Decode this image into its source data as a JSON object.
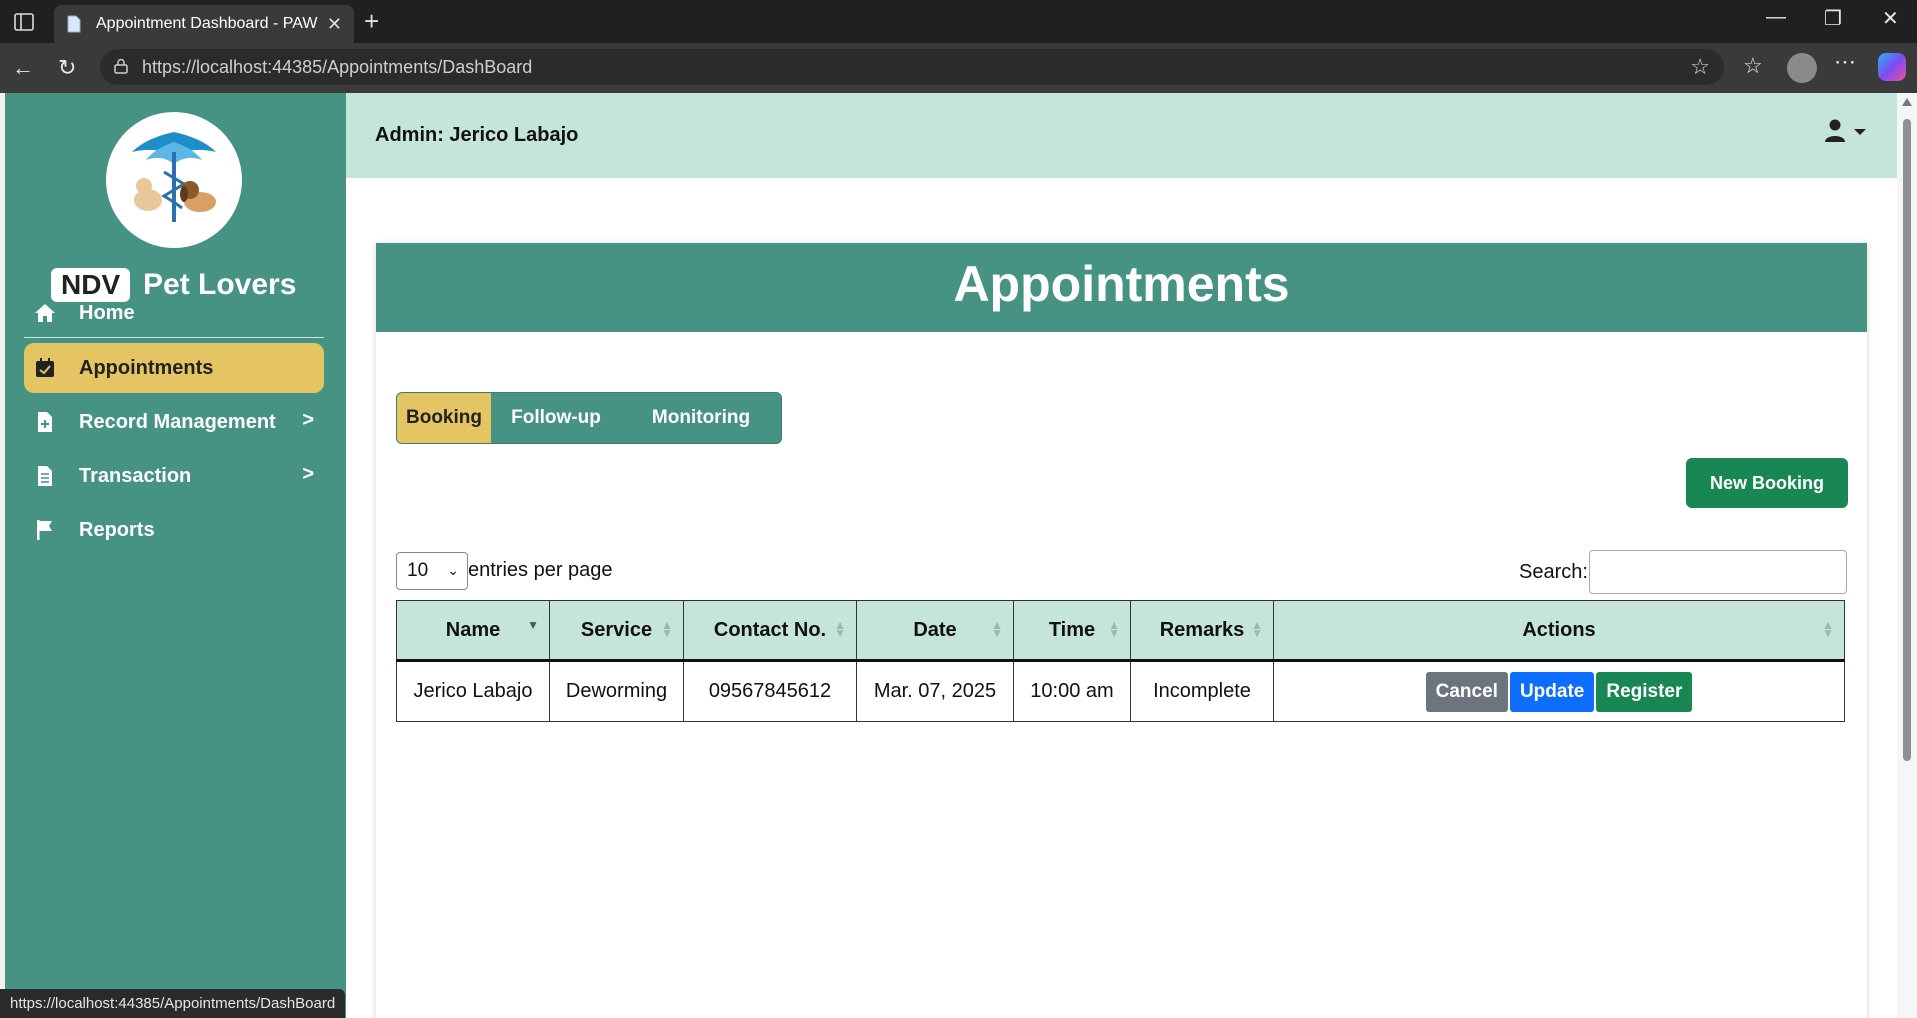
{
  "browser": {
    "tab_title": "Appointment Dashboard - PAWS_",
    "url_host": "https://localhost",
    "url_rest": ":44385/Appointments/DashBoard",
    "status_url": "https://localhost:44385/Appointments/DashBoard"
  },
  "sidebar": {
    "brand_badge": "NDV",
    "brand_name": "Pet Lovers",
    "items": [
      {
        "label": "Home",
        "icon": "home-icon",
        "chevron": ""
      },
      {
        "label": "Appointments",
        "icon": "calendar-check-icon",
        "chevron": ""
      },
      {
        "label": "Record Management",
        "icon": "file-plus-icon",
        "chevron": ">"
      },
      {
        "label": "Transaction",
        "icon": "file-text-icon",
        "chevron": ">"
      },
      {
        "label": "Reports",
        "icon": "flag-icon",
        "chevron": ""
      }
    ],
    "active_item": "Appointments"
  },
  "topbar": {
    "admin_label": "Admin: Jerico Labajo"
  },
  "main": {
    "title": "Appointments",
    "tabs": [
      "Booking",
      "Follow-up",
      "Monitoring"
    ],
    "active_tab": "Booking",
    "new_booking_label": "New Booking",
    "entries_value": "10",
    "entries_label": "entries per page",
    "search_label": "Search:",
    "search_value": "",
    "table": {
      "columns": [
        "Name",
        "Service",
        "Contact No.",
        "Date",
        "Time",
        "Remarks",
        "Actions"
      ],
      "rows": [
        {
          "name": "Jerico Labajo",
          "service": "Deworming",
          "contact": "09567845612",
          "date": "Mar. 07, 2025",
          "time": "10:00 am",
          "remarks": "Incomplete",
          "actions": [
            "Cancel",
            "Update",
            "Register"
          ]
        }
      ]
    }
  },
  "colors": {
    "teal": "#469384",
    "mint": "#c5e4dc",
    "gold": "#e5c463",
    "green": "#198754",
    "blue": "#0d6efd",
    "gray": "#6c757d"
  }
}
